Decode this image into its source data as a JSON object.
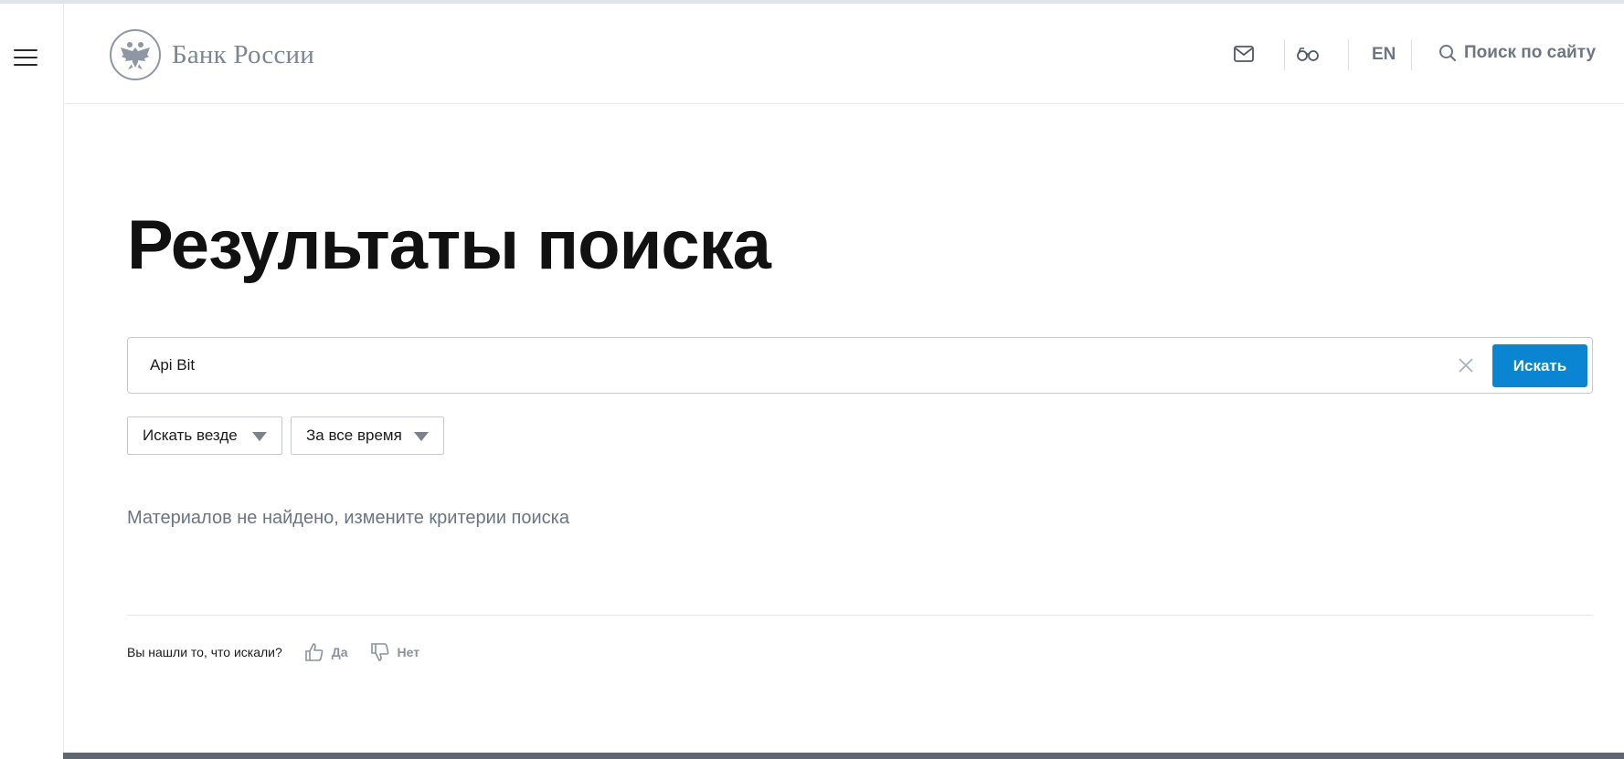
{
  "header": {
    "logo_text": "Банк России",
    "lang_label": "EN",
    "site_search_label": "Поиск по сайту",
    "icons": [
      "menu-icon",
      "emblem-icon",
      "mail-icon",
      "glasses-icon",
      "search-icon"
    ]
  },
  "main": {
    "title": "Результаты поиска",
    "search": {
      "value": "Api Bit",
      "button_label": "Искать"
    },
    "filters": {
      "scope_selected": "Искать везде",
      "period_selected": "За все время"
    },
    "empty_message": "Материалов не найдено, измените критерии поиска"
  },
  "feedback": {
    "question": "Вы нашли то, что искали?",
    "yes_label": "Да",
    "no_label": "Нет"
  },
  "colors": {
    "accent": "#0a85d1",
    "muted_text": "#6b7480",
    "footer_bar": "#5f6670"
  }
}
